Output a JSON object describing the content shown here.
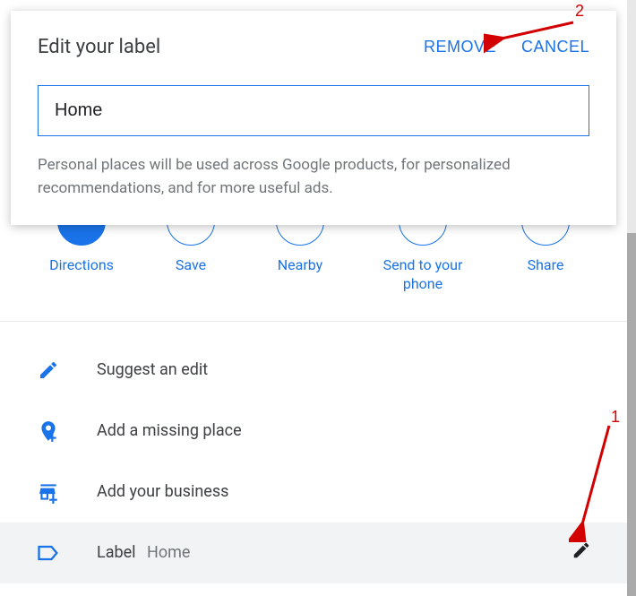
{
  "dialog": {
    "title": "Edit your label",
    "remove": "REMOVE",
    "cancel": "CANCEL",
    "input_value": "Home",
    "hint": "Personal places will be used across Google products, for personalized recommendations, and for more useful ads."
  },
  "actions": {
    "directions": "Directions",
    "save": "Save",
    "nearby": "Nearby",
    "send": "Send to your phone",
    "share": "Share"
  },
  "menu": {
    "suggest": "Suggest an edit",
    "missing": "Add a missing place",
    "business": "Add your business",
    "label_title": "Label",
    "label_value": "Home"
  },
  "annotations": {
    "one": "1",
    "two": "2"
  }
}
